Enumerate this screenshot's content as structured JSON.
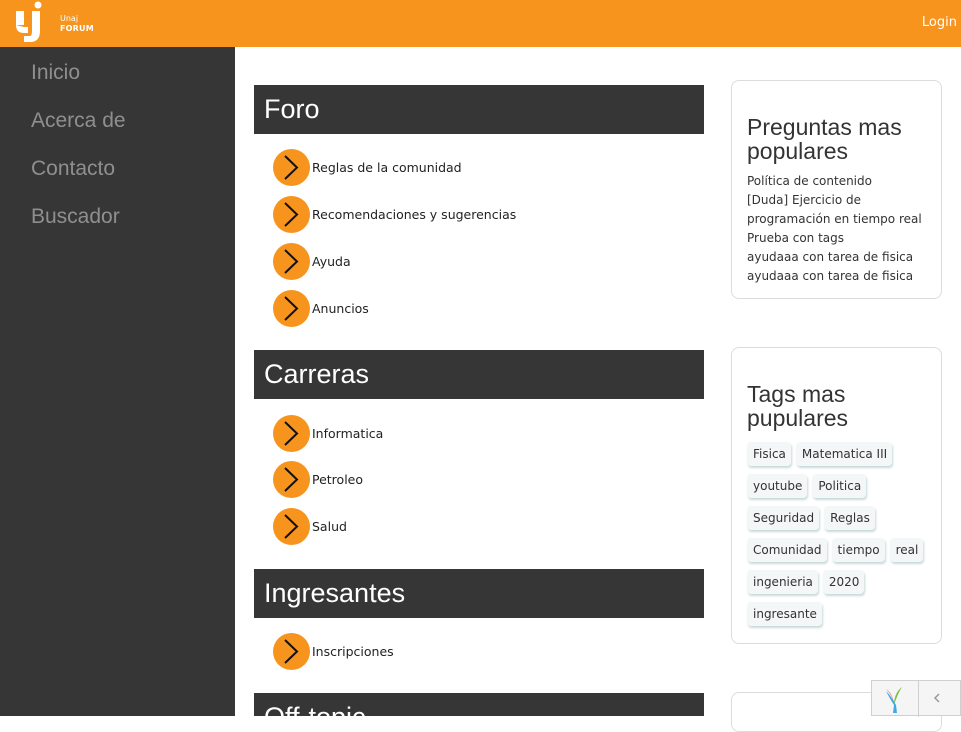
{
  "header": {
    "logo_small": "Unaj",
    "logo_big": "FORUM",
    "login_label": "Login"
  },
  "sidebar": {
    "items": [
      {
        "label": "Inicio"
      },
      {
        "label": "Acerca de"
      },
      {
        "label": "Contacto"
      },
      {
        "label": "Buscador"
      }
    ]
  },
  "sections": [
    {
      "title": "Foro",
      "items": [
        "Reglas de la comunidad",
        "Recomendaciones y sugerencias",
        "Ayuda",
        "Anuncios"
      ]
    },
    {
      "title": "Carreras",
      "items": [
        "Informatica",
        "Petroleo",
        "Salud"
      ]
    },
    {
      "title": "Ingresantes",
      "items": [
        "Inscripciones"
      ]
    },
    {
      "title": "Off-topic",
      "items": []
    }
  ],
  "popular": {
    "title": "Preguntas mas populares",
    "items": [
      "Política de contenido",
      "[Duda] Ejercicio de programación en tiempo real",
      "Prueba con tags",
      "ayudaaa con tarea de fisica",
      "ayudaaa con tarea de fisica"
    ]
  },
  "tags": {
    "title": "Tags mas pupulares",
    "items": [
      "Fisica",
      "Matematica III",
      "youtube",
      "Politica",
      "Seguridad",
      "Reglas",
      "Comunidad",
      "tiempo",
      "real",
      "ingenieria",
      "2020",
      "ingresante"
    ]
  },
  "colors": {
    "accent": "#f7941d",
    "sidebar_bg": "#363636",
    "heading_bg": "#363636"
  }
}
